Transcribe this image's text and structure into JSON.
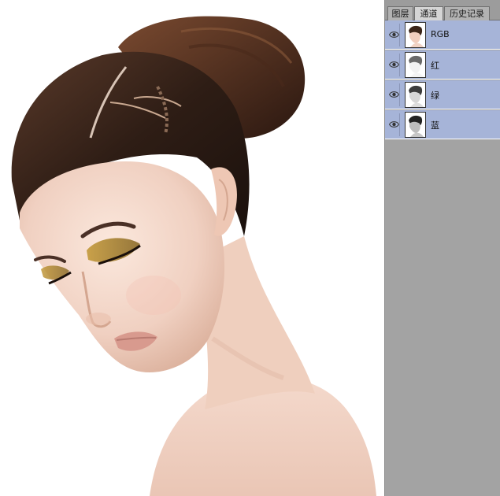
{
  "tabs": [
    {
      "label": "图层",
      "active": false
    },
    {
      "label": "通道",
      "active": true
    },
    {
      "label": "历史记录",
      "active": false
    }
  ],
  "channels": [
    {
      "name": "RGB",
      "visible": true,
      "thumb_tone": "color"
    },
    {
      "name": "红",
      "visible": true,
      "thumb_tone": "light"
    },
    {
      "name": "绿",
      "visible": true,
      "thumb_tone": "mid"
    },
    {
      "name": "蓝",
      "visible": true,
      "thumb_tone": "dark"
    }
  ],
  "colors": {
    "panel_bg": "#a3a3a3",
    "row_selected": "#a6b4d8",
    "canvas_bg": "#ffffff"
  }
}
